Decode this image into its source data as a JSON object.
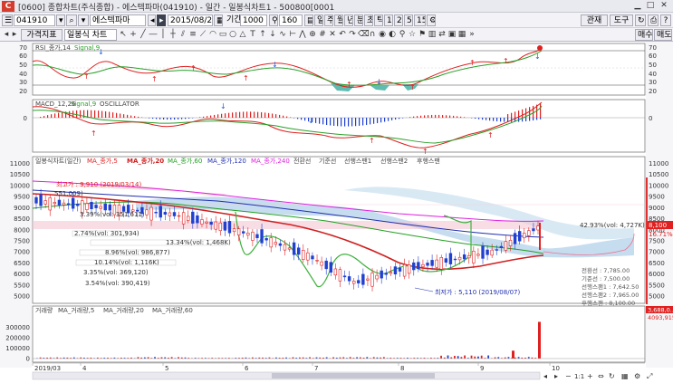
{
  "window": {
    "app_badge": "C",
    "title": "[0600] 종합차트(주식종합) - 에스텍파마(041910) - 일간 - 일봉식차트1 - 500800[0001"
  },
  "toolbar": {
    "code": "041910",
    "stock_name": "에스텍파마",
    "date": "2015/08/28",
    "period_label": "기간",
    "period_value": "1000",
    "count_value": "160",
    "period_buttons": [
      "일",
      "주",
      "월",
      "년",
      "분",
      "초",
      "틱",
      "1",
      "2",
      "5",
      "15"
    ],
    "right_buttons": [
      "관재",
      "도구"
    ],
    "price_type": "가격지표",
    "chart_type": "일봉식 차트",
    "buy_label": "매수",
    "sell_label": "매도"
  },
  "rsi": {
    "legend": [
      "RSI_종가,14",
      "Signal,9"
    ],
    "colors": {
      "rsi": "#e02020",
      "signal": "#2aa02a"
    },
    "axis_ticks": [
      70,
      60,
      50,
      40,
      30,
      20
    ],
    "levels": [
      70,
      30
    ]
  },
  "macd": {
    "legend": [
      "MACD_12,26",
      "Signal,9",
      "OSCILLATOR"
    ],
    "axis_ticks": [
      0
    ]
  },
  "price_panel": {
    "legend": [
      "일봉식차트(일간)",
      "MA_종가,5",
      "MA_종가,20",
      "MA_종가,60",
      "MA_종가,120",
      "MA_종가,240",
      "전환선",
      "기준선",
      "선행스팬1",
      "선행스팬2",
      "후행스팬"
    ],
    "y_ticks": [
      11000,
      10500,
      10000,
      9500,
      9000,
      8500,
      8000,
      7500,
      7000,
      6500,
      6000,
      5500,
      5000
    ],
    "high_label": "최고가 : 9,910 (2019/03/14)",
    "low_label": "최저가 : 5,110 (2019/08/07)",
    "current_price": "8,100",
    "current_change": "16.71%",
    "volume_profile": [
      "551,009)",
      "3.39%(vol: 351,611)",
      "2.74%(vol: 301,934)",
      "13.34%(vol: 1,468K)",
      "8.96%(vol: 986,877)",
      "10.14%(vol: 1,116K)",
      "3.35%(vol: 369,120)",
      "3.54%(vol: 390,419)",
      "42.93%(vol: 4,727K)"
    ],
    "ichimoku_info": [
      "전환선 : 7,785.00",
      "기준선 : 7,500.00",
      "선행스팬1 : 7,642.50",
      "선행스팬2 : 7,965.00",
      "후행스팬 : 8,100.00"
    ]
  },
  "volume_panel": {
    "legend": [
      "거래량",
      "MA_거래량,5",
      "MA_거래량,20",
      "MA_거래량,60"
    ],
    "y_ticks": [
      300000,
      200000,
      100000,
      0
    ],
    "current_volume": "3,688,0..",
    "current_volume2": "4093,915"
  },
  "x_axis": {
    "labels": [
      "2019/03",
      "4",
      "5",
      "6",
      "7",
      "8",
      "9",
      "10"
    ]
  },
  "bottom_bar": {
    "zoom": "1:1"
  },
  "chart_data": [
    {
      "type": "line",
      "name": "RSI",
      "x": [
        "2019/03",
        "4",
        "5",
        "6",
        "7",
        "8",
        "9",
        "10"
      ],
      "series": [
        {
          "name": "RSI_종가,14",
          "values": [
            52,
            44,
            58,
            46,
            57,
            41,
            38,
            49,
            66,
            72
          ]
        },
        {
          "name": "Signal,9",
          "values": [
            50,
            48,
            52,
            50,
            52,
            44,
            37,
            43,
            58,
            66
          ]
        }
      ],
      "ylim": [
        15,
        75
      ]
    },
    {
      "type": "bar",
      "name": "Volume",
      "x": [
        "2019/03",
        "4",
        "5",
        "6",
        "7",
        "8",
        "9",
        "10"
      ],
      "series": [
        {
          "name": "거래량",
          "values": [
            20000,
            15000,
            30000,
            10000,
            20000,
            25000,
            30000,
            12000,
            75000,
            350000,
            30000
          ]
        }
      ],
      "ylim": [
        0,
        380000
      ]
    },
    {
      "type": "line",
      "name": "Price",
      "x": [
        "2019/03",
        "4",
        "5",
        "6",
        "7",
        "8",
        "9",
        "10"
      ],
      "series": [
        {
          "name": "일봉식차트(일간)",
          "values": [
            9300,
            9100,
            8900,
            8700,
            8200,
            7600,
            6800,
            5600,
            6200,
            6600,
            7000,
            8100
          ]
        },
        {
          "name": "MA_종가,120",
          "values": [
            9000,
            8950,
            8900,
            8800,
            8600,
            8300,
            8000,
            7500,
            7200,
            7000,
            6900
          ]
        },
        {
          "name": "MA_종가,240",
          "values": [
            10200,
            10100,
            9950,
            9800,
            9650,
            9450,
            9200,
            8950,
            8750,
            8500
          ]
        }
      ],
      "ylim": [
        4800,
        11100
      ]
    }
  ]
}
